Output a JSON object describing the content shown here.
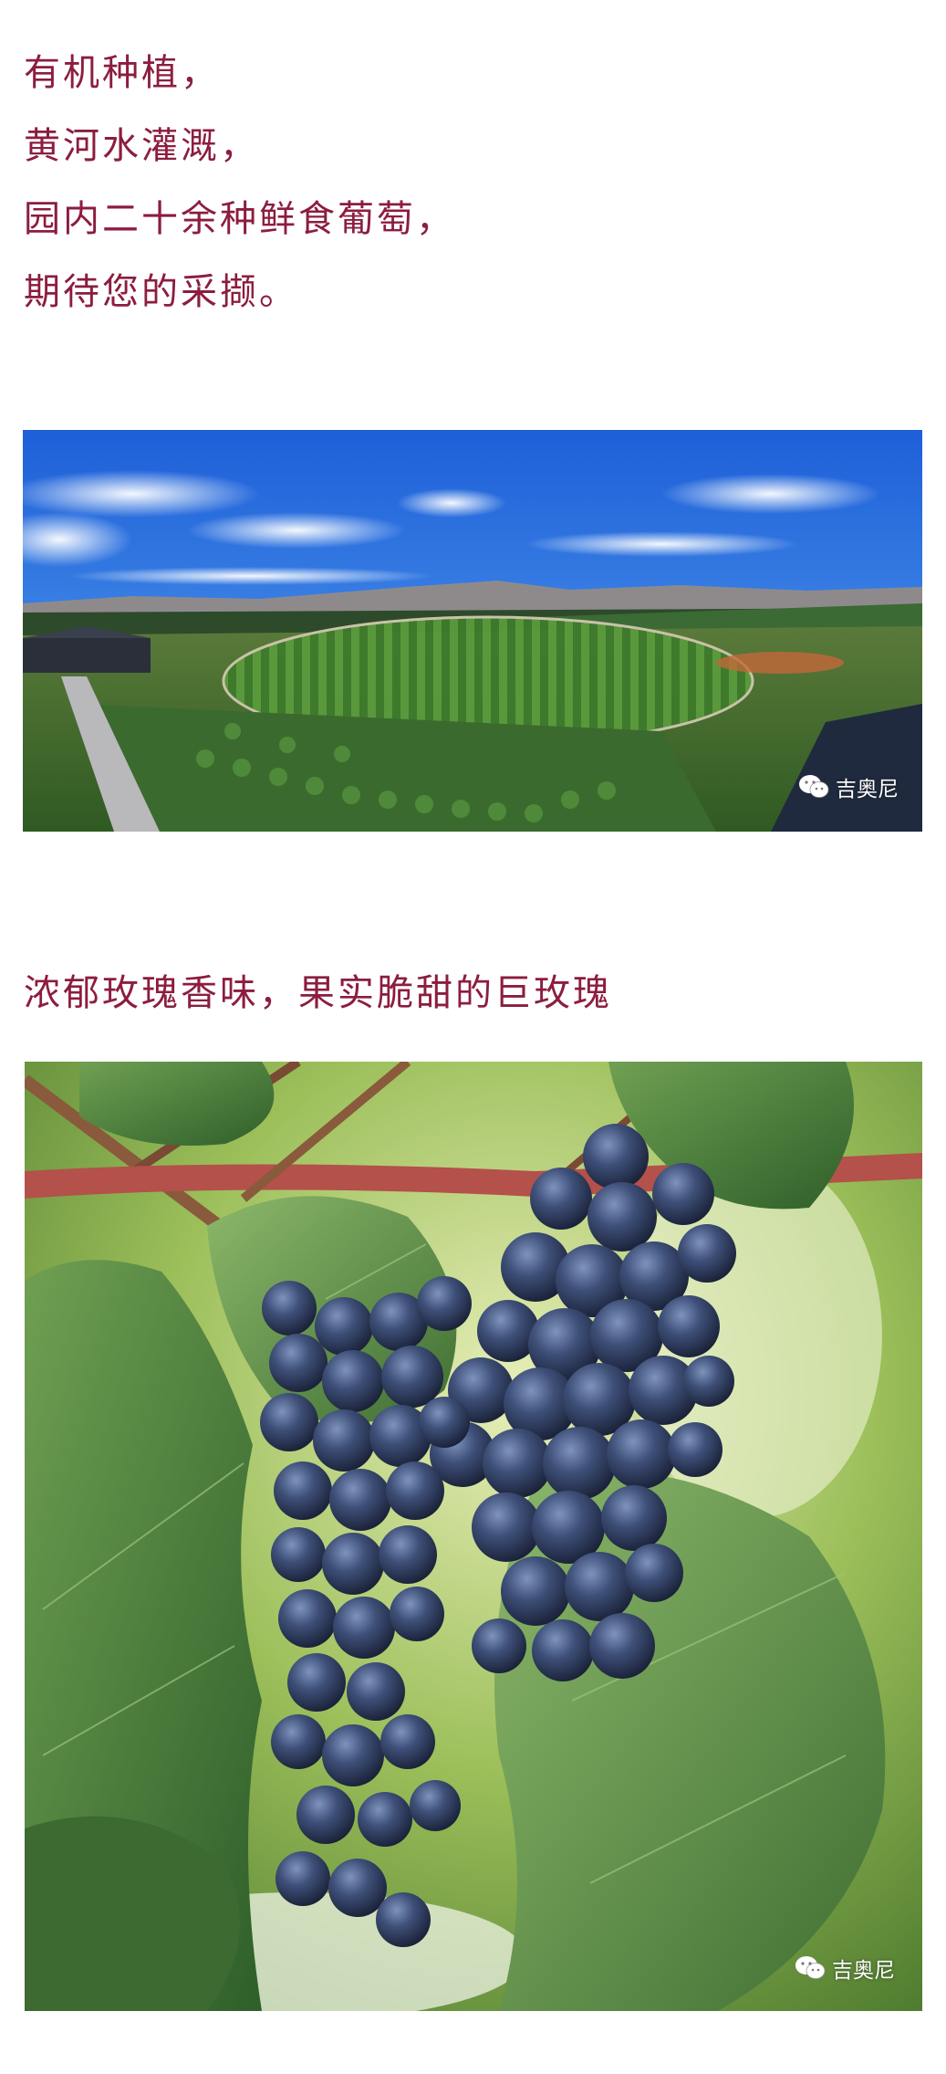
{
  "intro": {
    "lines": [
      "有机种植，",
      "黄河水灌溉，",
      "园内二十余种鲜食葡萄，",
      "期待您的采撷。"
    ]
  },
  "images": {
    "vineyard": {
      "watermark": "吉奥尼",
      "watermark_icon": "wechat-icon"
    },
    "grapes": {
      "watermark": "吉奥尼",
      "watermark_icon": "wechat-icon"
    }
  },
  "caption": "浓郁玫瑰香味，果实脆甜的巨玫瑰",
  "colors": {
    "text_accent": "#8c1d3f",
    "background": "#ffffff"
  }
}
